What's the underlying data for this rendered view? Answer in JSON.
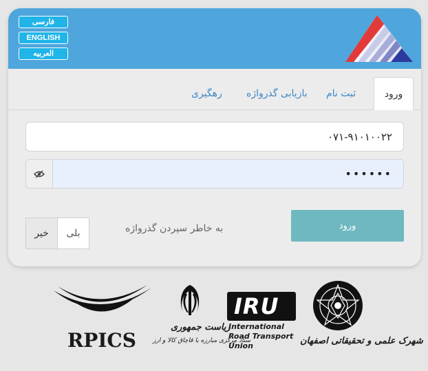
{
  "header": {
    "languages": [
      "فارسی",
      "ENGLISH",
      "العربیه"
    ],
    "logo_icon": "triangle-stripes-logo-icon",
    "colors": {
      "header_bg": "#4ea6dc",
      "lang_bg": "#20b4e8"
    }
  },
  "tabs": [
    {
      "label": "ورود",
      "active": true
    },
    {
      "label": "ثبت نام",
      "active": false
    },
    {
      "label": "بازیابی گذرواژه",
      "active": false
    },
    {
      "label": "رهگیری",
      "active": false
    }
  ],
  "form": {
    "username_value": "۰۷۱-۹۱۰۱۰۰۲۲",
    "password_value": "••••••",
    "show_password_icon": "eye-icon",
    "remember_label": "به خاطر سپردن گذرواژه",
    "remember_options": {
      "yes": "بلی",
      "no": "خیر",
      "selected": "no"
    },
    "submit_label": "ورود",
    "submit_color": "#6fb8c0"
  },
  "sponsors": {
    "isfahan": "شهرک علمی و تحقیقاتی اصفهان",
    "iru_logo": "IRU",
    "iru_lines": [
      "International",
      "Road Transport",
      "Union"
    ],
    "presidency_lines": [
      "ریاست جمهوری",
      "ستاد مرکزی مبارزه با قاچاق کالا و ارز"
    ],
    "rpics": "RPICS"
  }
}
